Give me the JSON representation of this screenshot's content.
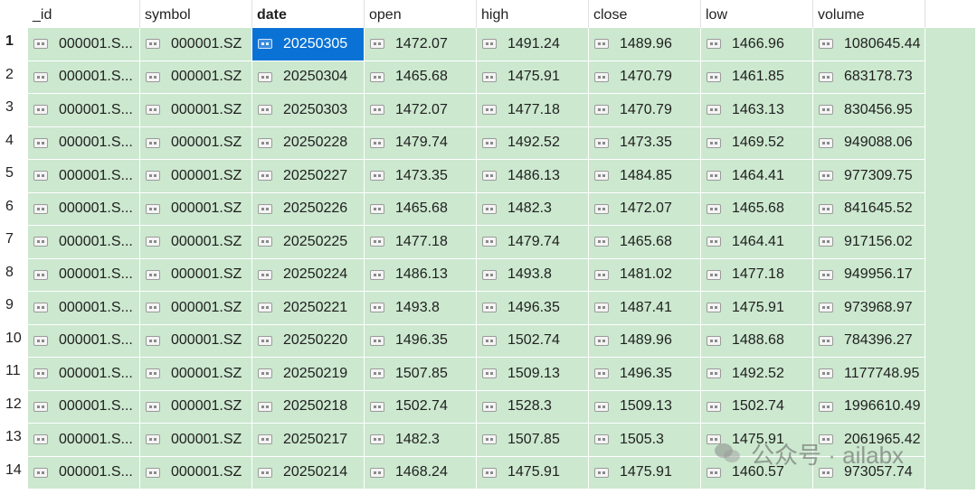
{
  "columns": [
    "_id",
    "symbol",
    "date",
    "open",
    "high",
    "close",
    "low",
    "volume"
  ],
  "sorted_column_index": 2,
  "selected_cell": {
    "row": 0,
    "col": 2
  },
  "rows": [
    {
      "num": "1",
      "cells": [
        "000001.S...",
        "000001.SZ",
        "20250305",
        "1472.07",
        "1491.24",
        "1489.96",
        "1466.96",
        "1080645.44"
      ]
    },
    {
      "num": "2",
      "cells": [
        "000001.S...",
        "000001.SZ",
        "20250304",
        "1465.68",
        "1475.91",
        "1470.79",
        "1461.85",
        "683178.73"
      ]
    },
    {
      "num": "3",
      "cells": [
        "000001.S...",
        "000001.SZ",
        "20250303",
        "1472.07",
        "1477.18",
        "1470.79",
        "1463.13",
        "830456.95"
      ]
    },
    {
      "num": "4",
      "cells": [
        "000001.S...",
        "000001.SZ",
        "20250228",
        "1479.74",
        "1492.52",
        "1473.35",
        "1469.52",
        "949088.06"
      ]
    },
    {
      "num": "5",
      "cells": [
        "000001.S...",
        "000001.SZ",
        "20250227",
        "1473.35",
        "1486.13",
        "1484.85",
        "1464.41",
        "977309.75"
      ]
    },
    {
      "num": "6",
      "cells": [
        "000001.S...",
        "000001.SZ",
        "20250226",
        "1465.68",
        "1482.3",
        "1472.07",
        "1465.68",
        "841645.52"
      ]
    },
    {
      "num": "7",
      "cells": [
        "000001.S...",
        "000001.SZ",
        "20250225",
        "1477.18",
        "1479.74",
        "1465.68",
        "1464.41",
        "917156.02"
      ]
    },
    {
      "num": "8",
      "cells": [
        "000001.S...",
        "000001.SZ",
        "20250224",
        "1486.13",
        "1493.8",
        "1481.02",
        "1477.18",
        "949956.17"
      ]
    },
    {
      "num": "9",
      "cells": [
        "000001.S...",
        "000001.SZ",
        "20250221",
        "1493.8",
        "1496.35",
        "1487.41",
        "1475.91",
        "973968.97"
      ]
    },
    {
      "num": "10",
      "cells": [
        "000001.S...",
        "000001.SZ",
        "20250220",
        "1496.35",
        "1502.74",
        "1489.96",
        "1488.68",
        "784396.27"
      ]
    },
    {
      "num": "11",
      "cells": [
        "000001.S...",
        "000001.SZ",
        "20250219",
        "1507.85",
        "1509.13",
        "1496.35",
        "1492.52",
        "1177748.95"
      ]
    },
    {
      "num": "12",
      "cells": [
        "000001.S...",
        "000001.SZ",
        "20250218",
        "1502.74",
        "1528.3",
        "1509.13",
        "1502.74",
        "1996610.49"
      ]
    },
    {
      "num": "13",
      "cells": [
        "000001.S...",
        "000001.SZ",
        "20250217",
        "1482.3",
        "1507.85",
        "1505.3",
        "1475.91",
        "2061965.42"
      ]
    },
    {
      "num": "14",
      "cells": [
        "000001.S...",
        "000001.SZ",
        "20250214",
        "1468.24",
        "1475.91",
        "1475.91",
        "1460.57",
        "973057.74"
      ]
    }
  ],
  "watermark": {
    "text": "公众号 · ailabx"
  },
  "colors": {
    "row_bg": "#cce8cf",
    "selected_bg": "#0b72d5",
    "header_bg": "#ffffff"
  }
}
